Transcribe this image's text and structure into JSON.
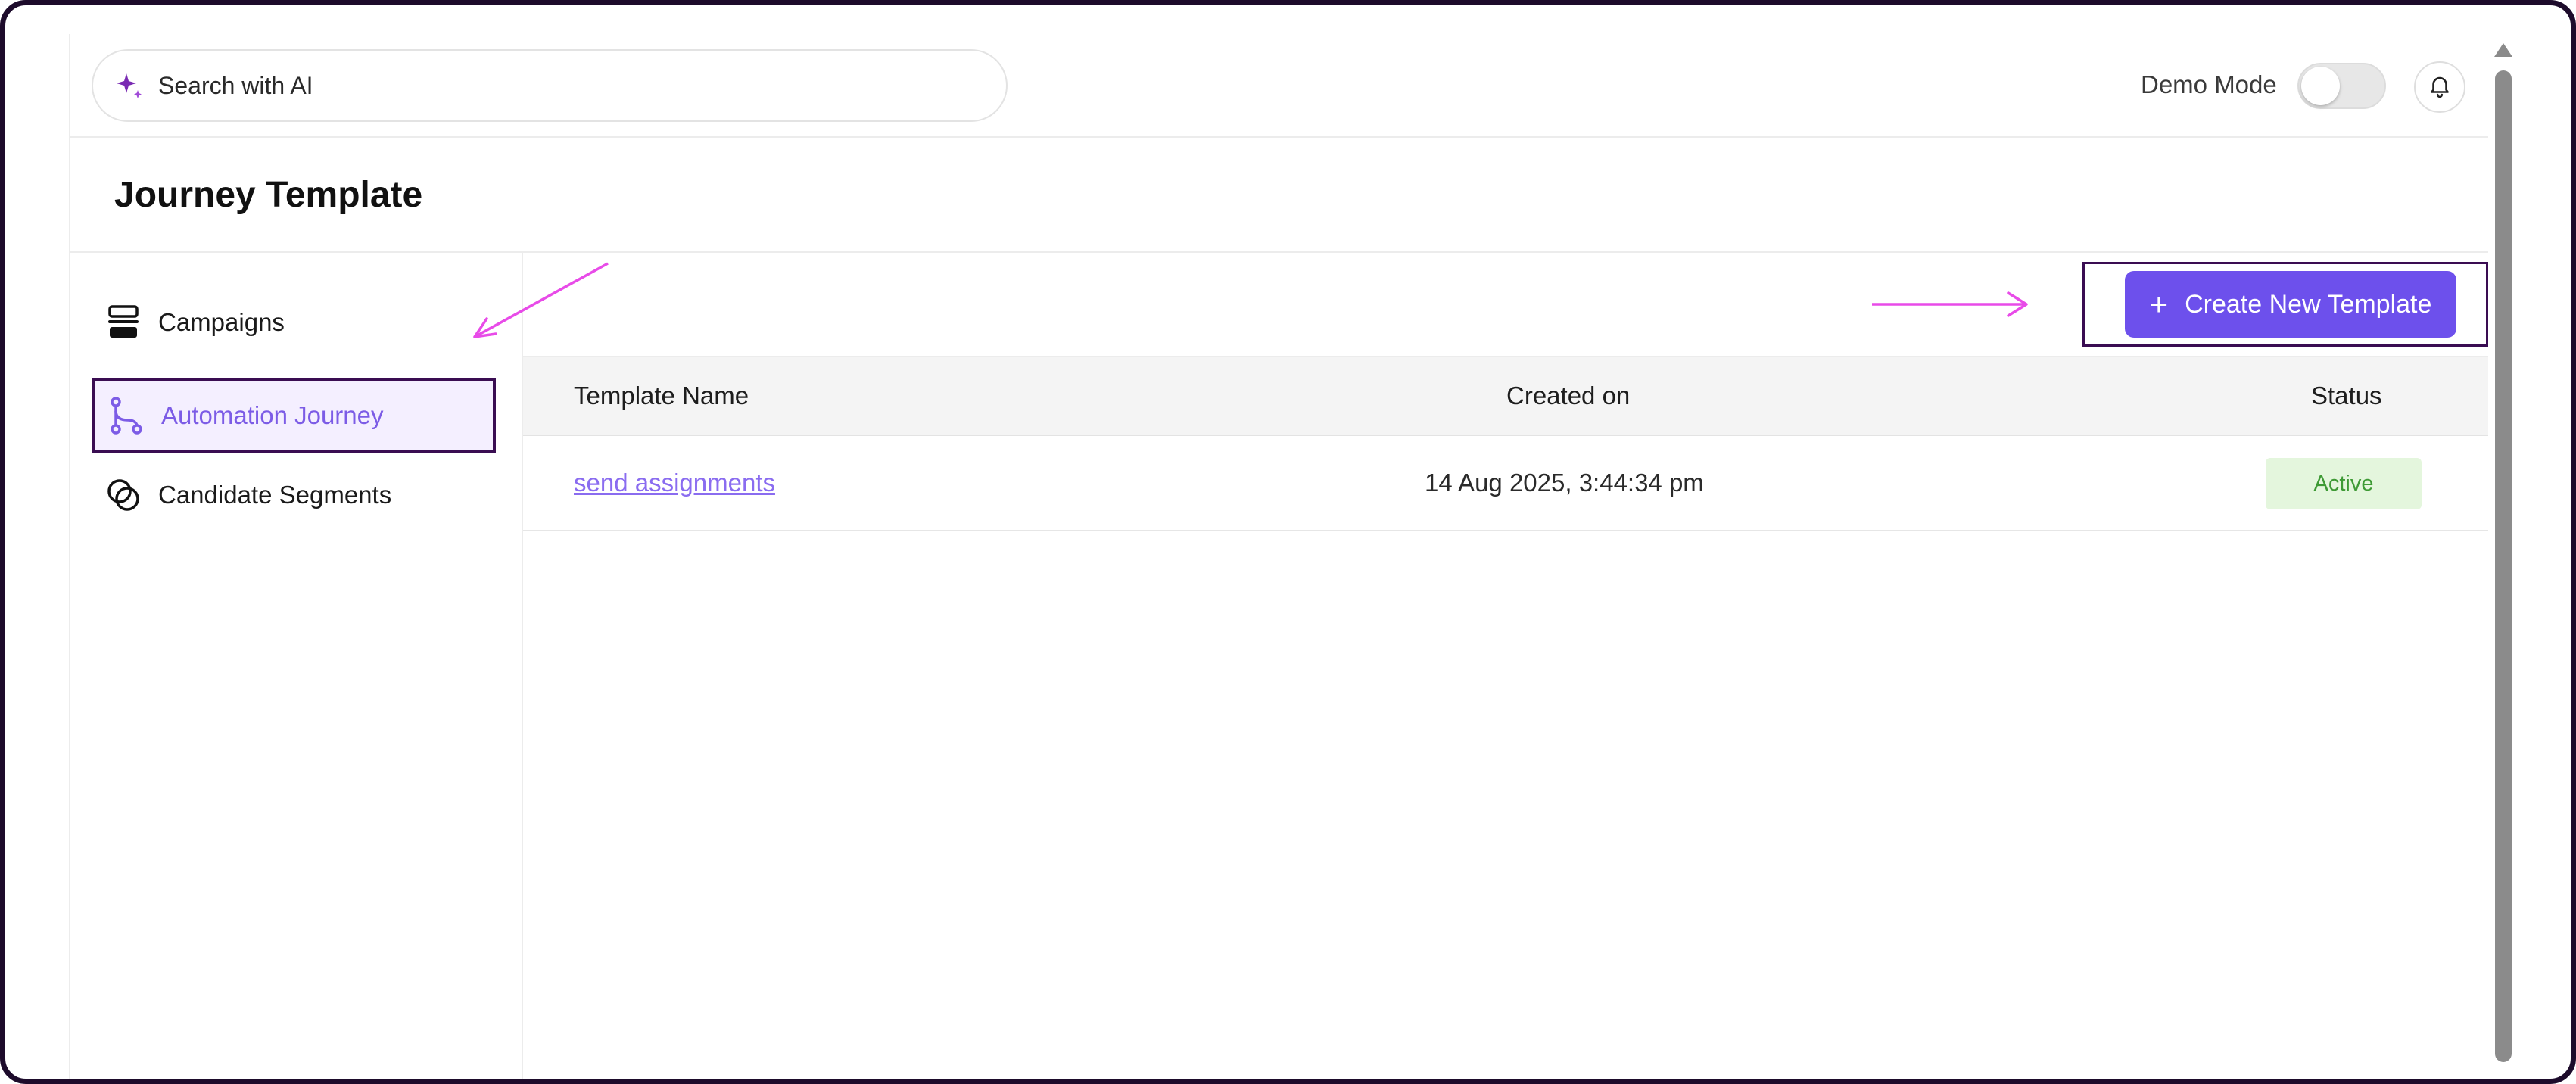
{
  "topbar": {
    "search_placeholder": "Search with AI",
    "demo_mode_label": "Demo Mode",
    "demo_mode_on": false
  },
  "page": {
    "title": "Journey Template"
  },
  "sidebar": {
    "items": [
      {
        "label": "Campaigns",
        "icon": "campaigns-icon",
        "active": false
      },
      {
        "label": "Automation Journey",
        "icon": "journey-branch-icon",
        "active": true
      },
      {
        "label": "Candidate Segments",
        "icon": "segments-icon",
        "active": false
      }
    ]
  },
  "toolbar": {
    "create_label": "Create New Template",
    "create_icon": "+"
  },
  "table": {
    "columns": [
      "Template Name",
      "Created on",
      "Status"
    ],
    "rows": [
      {
        "name": "send assignments",
        "created_on": "14 Aug 2025, 3:44:34 pm",
        "status": "Active"
      }
    ]
  },
  "colors": {
    "accent": "#6d50ec",
    "active_nav_text": "#7c5ce6",
    "annotation": "#e84be8",
    "status_active_bg": "#e4f6dd",
    "status_active_text": "#3e9a35"
  }
}
